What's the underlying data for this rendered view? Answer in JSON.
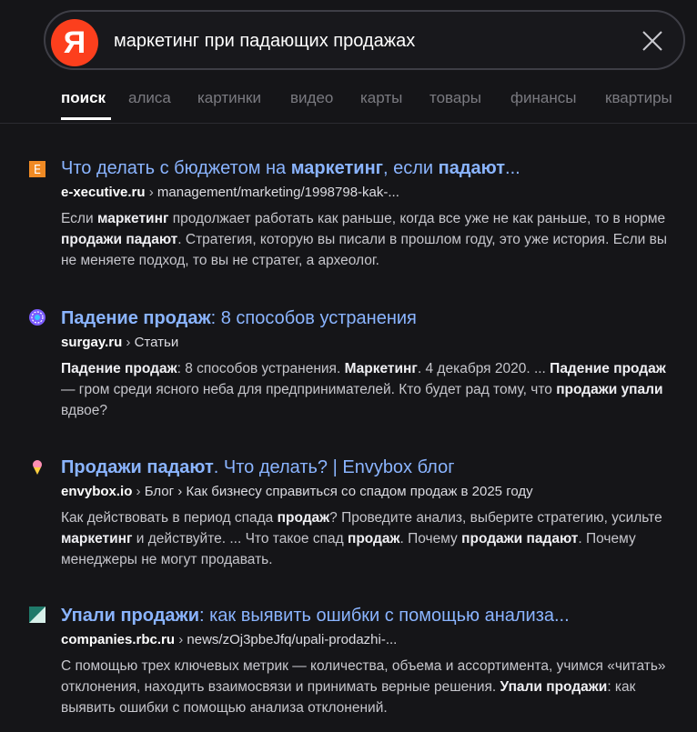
{
  "search": {
    "logo": "Я",
    "query": "маркетинг при падающих продажах"
  },
  "tabs": [
    {
      "label": "поиск",
      "active": true
    },
    {
      "label": "алиса"
    },
    {
      "label": "картинки"
    },
    {
      "label": "видео"
    },
    {
      "label": "карты"
    },
    {
      "label": "товары"
    },
    {
      "label": "финансы"
    },
    {
      "label": "квартиры"
    }
  ],
  "results": [
    {
      "favicon": "e-executive-icon",
      "favicon_letter": "E",
      "title": [
        {
          "t": "Что делать с бюджетом на "
        },
        {
          "t": "маркетинг",
          "b": true
        },
        {
          "t": ", если "
        },
        {
          "t": "падают",
          "b": true
        },
        {
          "t": "..."
        }
      ],
      "host": "e-xecutive.ru",
      "sep": " › ",
      "path": "management/marketing/1998798-kak-...",
      "snippet": [
        {
          "t": "Если "
        },
        {
          "t": "маркетинг",
          "b": true
        },
        {
          "t": " продолжает работать как раньше, когда все уже не как раньше, то в норме "
        },
        {
          "t": "продажи падают",
          "b": true
        },
        {
          "t": ". Стратегия, которую вы писали в прошлом году, это уже история. Если вы не меняете подход, то вы не стратег, а археолог."
        }
      ]
    },
    {
      "favicon": "surgay-icon",
      "title": [
        {
          "t": "Падение продаж",
          "b": true
        },
        {
          "t": ": 8 способов устранения"
        }
      ],
      "host": "surgay.ru",
      "sep": " › ",
      "path": "Статьи",
      "snippet": [
        {
          "t": "Падение продаж",
          "b": true
        },
        {
          "t": ": 8 способов устранения. "
        },
        {
          "t": "Маркетинг",
          "b": true
        },
        {
          "t": ". 4 декабря 2020. ... "
        },
        {
          "t": "Падение продаж",
          "b": true
        },
        {
          "t": " — гром среди ясного неба для предпринимателей. Кто будет рад тому, что "
        },
        {
          "t": "продажи упали",
          "b": true
        },
        {
          "t": " вдвое?"
        }
      ]
    },
    {
      "favicon": "envybox-icon",
      "title": [
        {
          "t": "Продажи падают",
          "b": true
        },
        {
          "t": ". Что делать? | Envybox блог"
        }
      ],
      "host": "envybox.io",
      "sep": " › ",
      "path": "Блог › Как бизнесу справиться со спадом продаж в 2025 году",
      "snippet": [
        {
          "t": "Как действовать в период спада "
        },
        {
          "t": "продаж",
          "b": true
        },
        {
          "t": "? Проведите анализ, выберите страте­гию, усильте "
        },
        {
          "t": "маркетинг",
          "b": true
        },
        {
          "t": " и действуйте. ... Что такое спад "
        },
        {
          "t": "продаж",
          "b": true
        },
        {
          "t": ". Почему "
        },
        {
          "t": "про­дажи падают",
          "b": true
        },
        {
          "t": ". Почему менеджеры не могут продавать."
        }
      ]
    },
    {
      "favicon": "rbc-companies-icon",
      "title": [
        {
          "t": "Упали продажи",
          "b": true
        },
        {
          "t": ": как выявить ошибки с помощью анализа..."
        }
      ],
      "host": "companies.rbc.ru",
      "sep": " › ",
      "path": "news/zOj3pbeJfq/upali-prodazhi-...",
      "snippet": [
        {
          "t": "С помощью трех ключевых метрик — количества, объема и ассортимента, учимся «читать» отклонения, находить взаимосвязи и принимать верные решения. "
        },
        {
          "t": "Упали продажи",
          "b": true
        },
        {
          "t": ": как выявить ошибки с помощью анализа отклонений."
        }
      ]
    }
  ]
}
